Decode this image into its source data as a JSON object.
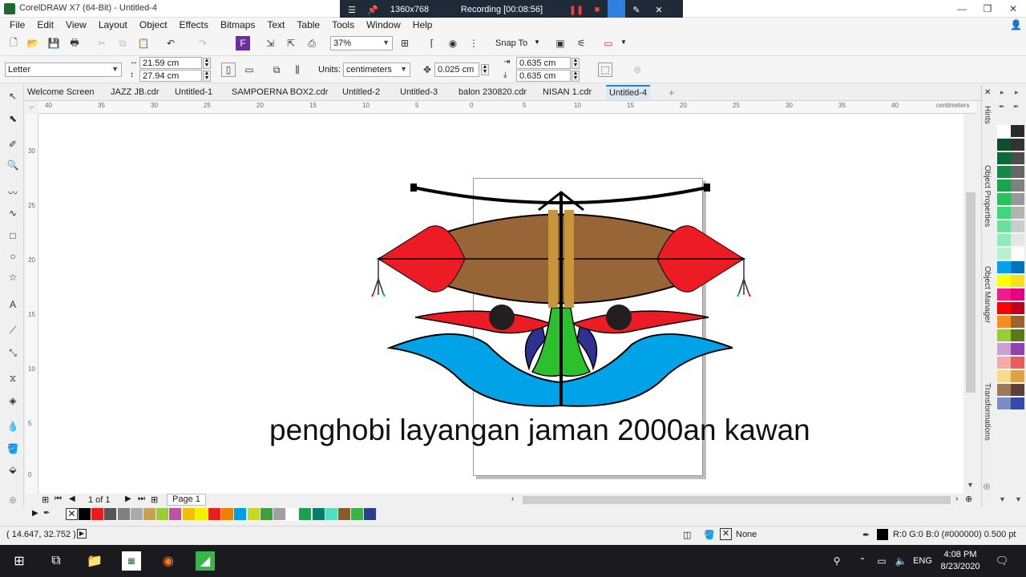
{
  "window": {
    "title": "CorelDRAW X7 (64-Bit) - Untitled-4"
  },
  "recorder": {
    "resolution": "1360x768",
    "status": "Recording [00:08:56]"
  },
  "menu": [
    "File",
    "Edit",
    "View",
    "Layout",
    "Object",
    "Effects",
    "Bitmaps",
    "Text",
    "Table",
    "Tools",
    "Window",
    "Help"
  ],
  "toolbar": {
    "zoom": "37%",
    "snap_to": "Snap To"
  },
  "property_bar": {
    "page_size": "Letter",
    "width": "21.59 cm",
    "height": "27.94 cm",
    "units_label": "Units:",
    "units": "centimeters",
    "nudge": "0.025 cm",
    "dup_x": "0.635 cm",
    "dup_y": "0.635 cm"
  },
  "tabs": [
    "Welcome Screen",
    "JAZZ JB.cdr",
    "Untitled-1",
    "SAMPOERNA BOX2.cdr",
    "Untitled-2",
    "Untitled-3",
    "balon 230820.cdr",
    "NISAN 1.cdr",
    "Untitled-4"
  ],
  "rulers": {
    "h_ticks": [
      "40",
      "35",
      "30",
      "25",
      "20",
      "15",
      "10",
      "5",
      "0",
      "5",
      "10",
      "15",
      "20",
      "25",
      "30",
      "35",
      "40"
    ],
    "h_unit": "centimeters",
    "v_ticks": [
      "30",
      "25",
      "20",
      "15",
      "10",
      "5",
      "0"
    ],
    "v_unit": "centimeters"
  },
  "canvas": {
    "overlay_text": "penghobi layangan jaman 2000an kawan"
  },
  "page_nav": {
    "count": "1 of 1",
    "page_tab": "Page 1"
  },
  "dockers": [
    "Hints",
    "Object Properties",
    "Object Manager",
    "Transformations"
  ],
  "palette_vertical": [
    "#ffffff",
    "#2a2a2a",
    "#0e4f2b",
    "#333333",
    "#0b6b36",
    "#4d4d4d",
    "#138a43",
    "#666666",
    "#1ba34f",
    "#808080",
    "#29c15d",
    "#999999",
    "#3dd879",
    "#b3b3b3",
    "#66e39a",
    "#cccccc",
    "#8eecb6",
    "#e6e6e6",
    "#b6f2d0",
    "#ffffff",
    "#00a2e8",
    "#0072bc",
    "#ffff00",
    "#f7e01a",
    "#ed1c8a",
    "#e4007f",
    "#ff0000",
    "#c0001a",
    "#f78f1e",
    "#996633",
    "#9acd32",
    "#5a7a1a",
    "#c7a2cf",
    "#8e44ad",
    "#f5a9a9",
    "#e85c5c",
    "#f9d98a",
    "#d9a441",
    "#a0785a",
    "#5d4037",
    "#7b8cc7",
    "#3949ab"
  ],
  "palette_horizontal": [
    "#000000",
    "#e81c1c",
    "#555555",
    "#808080",
    "#aaaaaa",
    "#c8a050",
    "#9acd32",
    "#c050a0",
    "#f0c000",
    "#f0f000",
    "#e82020",
    "#f08000",
    "#00a0e0",
    "#c8d820",
    "#40a040",
    "#a0a0a0",
    "#ffffff",
    "#16a34a",
    "#0c7a6a",
    "#50e0c0",
    "#8b5a2b",
    "#3cb04a",
    "#2c3e8c"
  ],
  "status": {
    "coords": "( 14.647, 32.752 )",
    "fill": "None",
    "outline": "R:0 G:0 B:0 (#000000)  0.500 pt"
  },
  "taskbar": {
    "lang": "ENG",
    "time": "4:08 PM",
    "date": "8/23/2020"
  }
}
